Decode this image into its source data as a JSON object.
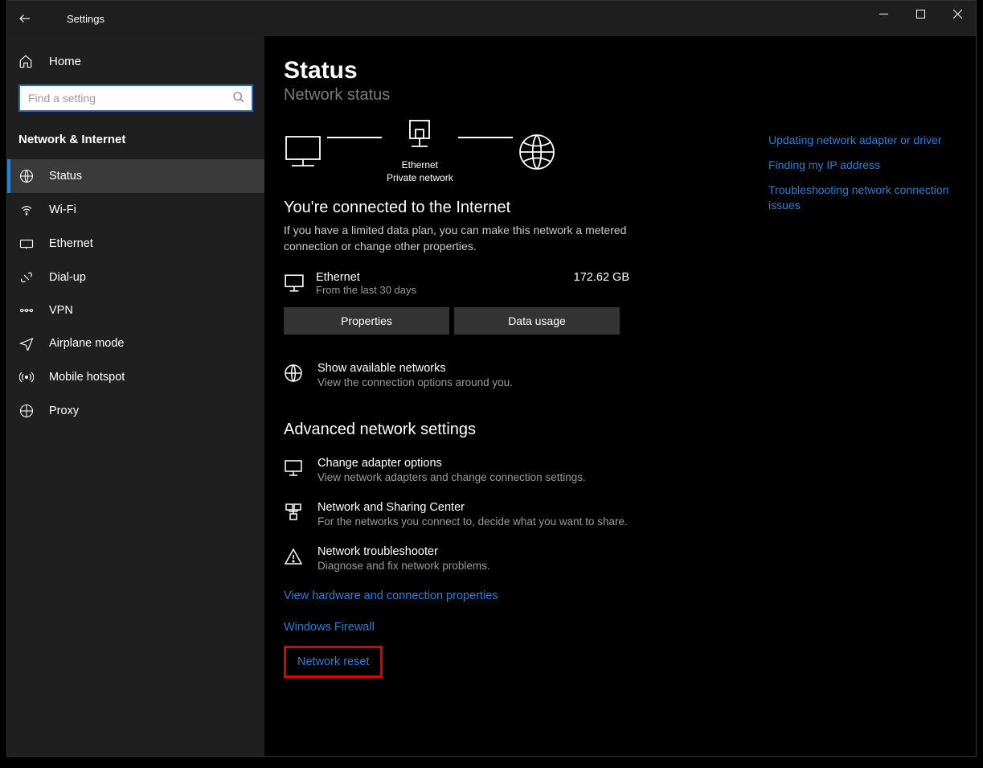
{
  "titlebar": {
    "app": "Settings"
  },
  "sidebar": {
    "home": "Home",
    "search_placeholder": "Find a setting",
    "category": "Network & Internet",
    "items": [
      {
        "label": "Status"
      },
      {
        "label": "Wi-Fi"
      },
      {
        "label": "Ethernet"
      },
      {
        "label": "Dial-up"
      },
      {
        "label": "VPN"
      },
      {
        "label": "Airplane mode"
      },
      {
        "label": "Mobile hotspot"
      },
      {
        "label": "Proxy"
      }
    ]
  },
  "main": {
    "title": "Status",
    "section_heading": "Network status",
    "diagram": {
      "mid_caption1": "Ethernet",
      "mid_caption2": "Private network"
    },
    "connected_h": "You're connected to the Internet",
    "connected_sub": "If you have a limited data plan, you can make this network a metered connection or change other properties.",
    "usage": {
      "name": "Ethernet",
      "sub": "From the last 30 days",
      "amount": "172.62 GB"
    },
    "btn_properties": "Properties",
    "btn_datausage": "Data usage",
    "show_networks": {
      "title": "Show available networks",
      "sub": "View the connection options around you."
    },
    "advanced_h": "Advanced network settings",
    "adapter": {
      "title": "Change adapter options",
      "sub": "View network adapters and change connection settings."
    },
    "sharing": {
      "title": "Network and Sharing Center",
      "sub": "For the networks you connect to, decide what you want to share."
    },
    "trouble": {
      "title": "Network troubleshooter",
      "sub": "Diagnose and fix network problems."
    },
    "link_hardware": "View hardware and connection properties",
    "link_firewall": "Windows Firewall",
    "link_reset": "Network reset"
  },
  "right": {
    "l1": "Updating network adapter or driver",
    "l2": "Finding my IP address",
    "l3": "Troubleshooting network connection issues"
  }
}
